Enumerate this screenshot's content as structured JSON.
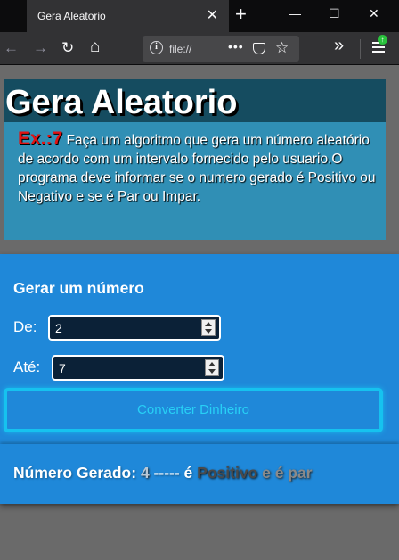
{
  "browser": {
    "tab_title": "Gera Aleatorio",
    "url": "file://",
    "close_glyph": "✕",
    "new_tab_glyph": "+",
    "minimize_glyph": "—",
    "maximize_glyph": "☐",
    "window_close_glyph": "✕",
    "back_glyph": "←",
    "forward_glyph": "→",
    "reload_glyph": "↻",
    "home_glyph": "⌂",
    "info_glyph": "i",
    "dots_glyph": "•••",
    "star_glyph": "☆",
    "overflow_glyph": "»",
    "update_glyph": "↑"
  },
  "header": {
    "title": "Gera Aleatorio",
    "exercise_label": "Ex.:7",
    "description": " Faça um algoritmo que gera um número aleatório de acordo com um intervalo fornecido pelo usuario.O programa deve informar se o numero gerado é Positivo ou Negativo e se é Par ou Impar."
  },
  "form": {
    "title": "Gerar um número",
    "from_label": "De:",
    "from_value": "2",
    "to_label": "Até:",
    "to_value": "7",
    "button_label": "Converter Dinheiro"
  },
  "result": {
    "prefix": "Número Gerado: ",
    "number": "4",
    "separator": " ----- é ",
    "sign": "Positivo",
    "parity": " e é par"
  },
  "colors": {
    "panel": "#1f88d9",
    "header_box": "#308fb5",
    "title_bar": "#154c60",
    "button_border": "#16c2ef",
    "exercise_label": "#e01212"
  }
}
